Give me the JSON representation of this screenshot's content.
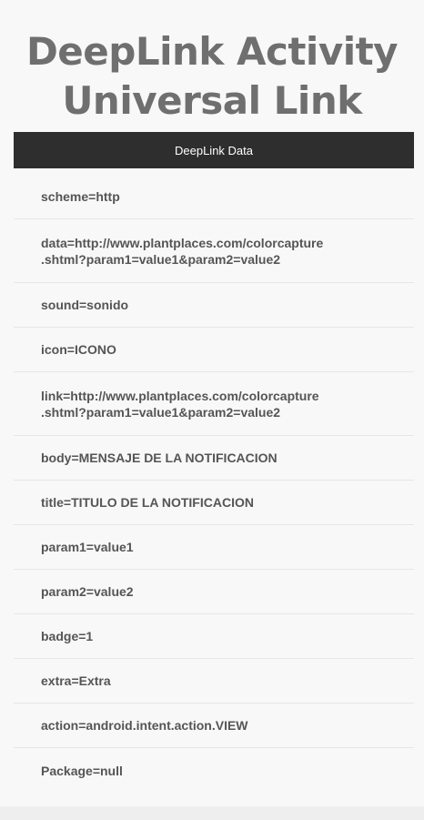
{
  "title": {
    "line1": "DeepLink Activity",
    "line2": "Universal Link"
  },
  "data_bar_label": "DeepLink Data",
  "items": [
    "scheme=http",
    "data=http://www.plantplaces.com/colorcapture\n.shtml?param1=value1&param2=value2",
    "sound=sonido",
    "icon=ICONO",
    "link=http://www.plantplaces.com/colorcapture\n.shtml?param1=value1&param2=value2",
    "body=MENSAJE DE LA NOTIFICACION",
    "title=TITULO DE LA NOTIFICACION",
    "param1=value1",
    "param2=value2",
    "badge=1",
    "extra=Extra",
    "action=android.intent.action.VIEW",
    "Package=null"
  ]
}
